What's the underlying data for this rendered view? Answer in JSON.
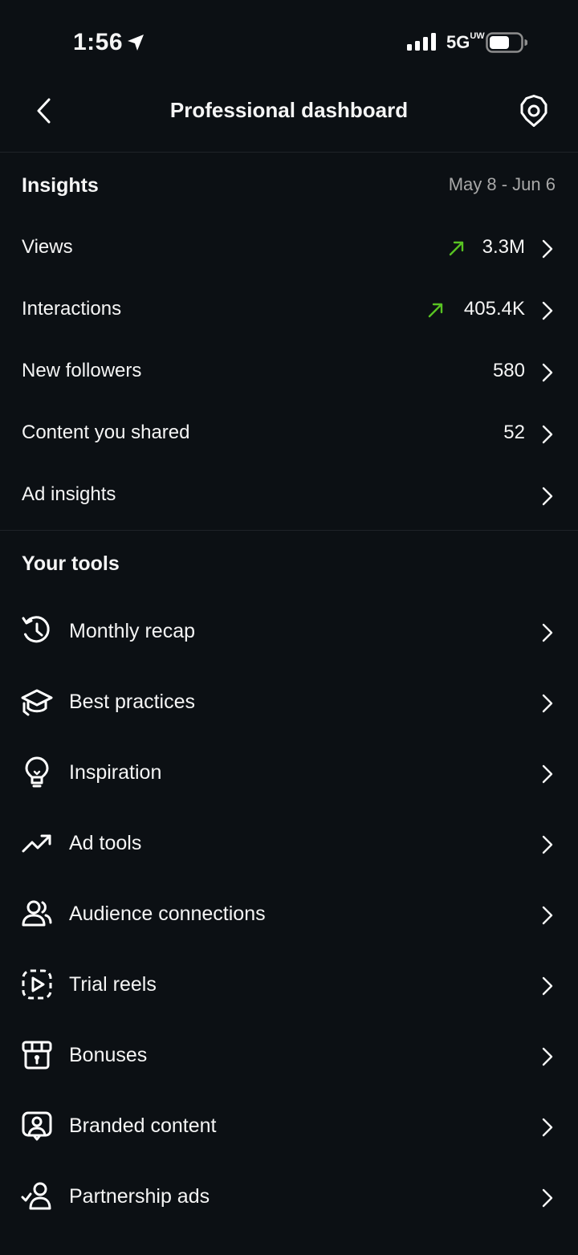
{
  "status_bar": {
    "time": "1:56",
    "network": "5G",
    "network_sup": "UW"
  },
  "nav": {
    "title": "Professional dashboard"
  },
  "insights": {
    "title": "Insights",
    "date_range": "May 8 - Jun 6",
    "rows": [
      {
        "label": "Views",
        "value": "3.3M",
        "trend": "up"
      },
      {
        "label": "Interactions",
        "value": "405.4K",
        "trend": "up"
      },
      {
        "label": "New followers",
        "value": "580"
      },
      {
        "label": "Content you shared",
        "value": "52"
      },
      {
        "label": "Ad insights",
        "value": ""
      }
    ]
  },
  "tools": {
    "title": "Your tools",
    "items": [
      {
        "label": "Monthly recap",
        "icon": "history-icon"
      },
      {
        "label": "Best practices",
        "icon": "graduation-cap-icon"
      },
      {
        "label": "Inspiration",
        "icon": "lightbulb-icon"
      },
      {
        "label": "Ad tools",
        "icon": "trending-up-icon"
      },
      {
        "label": "Audience connections",
        "icon": "audience-icon"
      },
      {
        "label": "Trial reels",
        "icon": "trial-reels-icon"
      },
      {
        "label": "Bonuses",
        "icon": "gift-box-icon"
      },
      {
        "label": "Branded content",
        "icon": "branded-content-icon"
      },
      {
        "label": "Partnership ads",
        "icon": "partnership-icon"
      }
    ]
  },
  "colors": {
    "background": "#0c1014",
    "text": "#f5f5f5",
    "secondary": "#a8a8a8",
    "trend_up": "#58c322",
    "divider": "#1f2328"
  }
}
